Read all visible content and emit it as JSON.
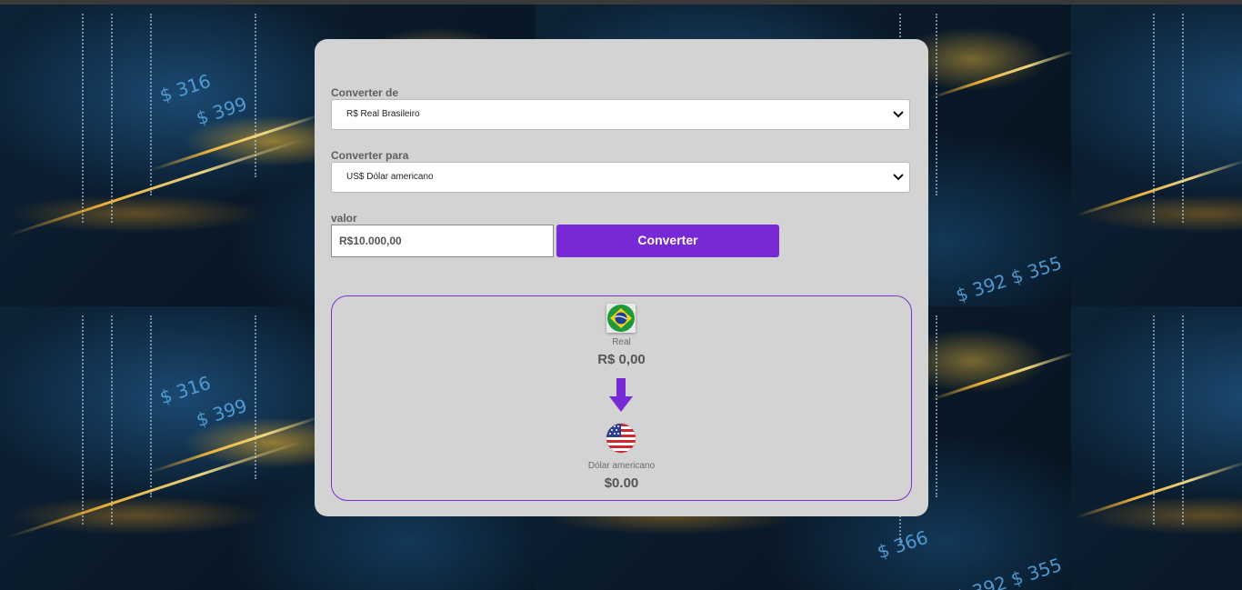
{
  "form": {
    "from_label": "Converter de",
    "from_selected": "R$ Real Brasileiro",
    "to_label": "Converter para",
    "to_selected": "US$ Dólar americano",
    "value_label": "valor",
    "value_input": "R$10.000,00",
    "convert_button": "Converter"
  },
  "result": {
    "from_currency_name": "Real",
    "from_amount": "R$ 0,00",
    "to_currency_name": "Dólar americano",
    "to_amount": "$0.00"
  },
  "colors": {
    "accent": "#7629d4",
    "panel": "#d3d3d3"
  },
  "icons": [
    "brazil-flag-icon",
    "arrow-down-icon",
    "usa-flag-icon",
    "chevron-down-icon"
  ]
}
